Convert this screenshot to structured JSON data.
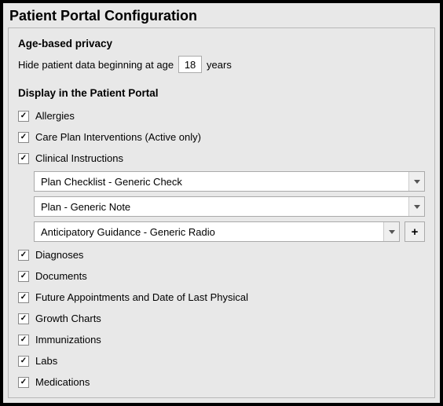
{
  "window": {
    "title": "Patient Portal Configuration"
  },
  "privacy": {
    "heading": "Age-based privacy",
    "label_before": "Hide patient data beginning at age",
    "age_value": "18",
    "label_after": "years"
  },
  "display": {
    "heading": "Display in the Patient Portal",
    "options": [
      {
        "label": "Allergies",
        "checked": true
      },
      {
        "label": "Care Plan Interventions (Active only)",
        "checked": true
      },
      {
        "label": "Clinical Instructions",
        "checked": true
      },
      {
        "label": "Diagnoses",
        "checked": true
      },
      {
        "label": "Documents",
        "checked": true
      },
      {
        "label": "Future Appointments and Date of Last Physical",
        "checked": true
      },
      {
        "label": "Growth Charts",
        "checked": true
      },
      {
        "label": "Immunizations",
        "checked": true
      },
      {
        "label": "Labs",
        "checked": true
      },
      {
        "label": "Medications",
        "checked": true
      }
    ],
    "clinical_instructions_dropdowns": [
      {
        "selected": "Plan Checklist - Generic Check",
        "has_add": false
      },
      {
        "selected": "Plan - Generic Note",
        "has_add": false
      },
      {
        "selected": "Anticipatory Guidance - Generic Radio",
        "has_add": true
      }
    ],
    "add_button_label": "+"
  }
}
